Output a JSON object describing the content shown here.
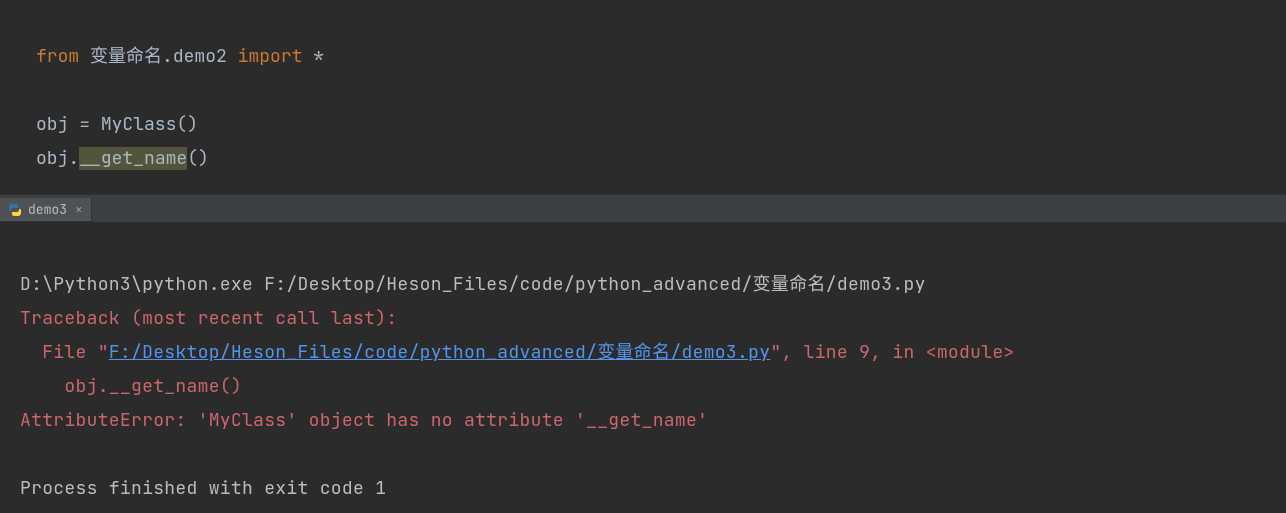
{
  "editor": {
    "line1": {
      "kw_from": "from",
      "pkg": "变量命名",
      "dot": ".",
      "mod": "demo2",
      "kw_import": "import",
      "star": "*"
    },
    "line2": "",
    "line3": {
      "lhs": "obj",
      "eq": " = ",
      "cls": "MyClass",
      "call": "()"
    },
    "line4": {
      "obj": "obj",
      "dot": ".",
      "method": "__get_name",
      "call": "()"
    }
  },
  "tab": {
    "name": "demo3",
    "close": "×"
  },
  "console": {
    "cmd": "D:\\Python3\\python.exe F:/Desktop/Heson_Files/code/python_advanced/变量命名/demo3.py",
    "tb_header": "Traceback (most recent call last):",
    "file_prefix": "  File \"",
    "file_path": "F:/Desktop/Heson_Files/code/python_advanced/变量命名/demo3.py",
    "file_suffix1": "\", line ",
    "line_no": "9",
    "file_suffix2": ", in ",
    "module": "<module>",
    "src_line": "    obj.__get_name()",
    "attr_err": "AttributeError: 'MyClass' object has no attribute '__get_name'",
    "blank": "",
    "exit": "Process finished with exit code 1"
  }
}
